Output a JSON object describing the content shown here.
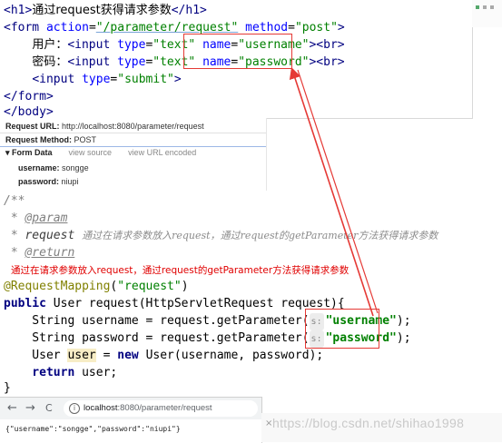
{
  "html_code": {
    "line1": {
      "open": "<h1>",
      "text": "通过request获得请求参数",
      "close": "</h1>"
    },
    "line2": {
      "prefix": "<form ",
      "action_attr": "action",
      "action_val": "\"/parameter/request\"",
      "method_attr": "method",
      "method_val": "\"post\"",
      "suffix": ">"
    },
    "line3": {
      "label": "用户：",
      "tag": "<input ",
      "type_attr": "type",
      "type_val": "\"text\"",
      "name_attr": "name",
      "name_val": "\"username\"",
      "suffix": "><br>"
    },
    "line4": {
      "label": "密码：",
      "tag": "<input ",
      "type_attr": "type",
      "type_val": "\"text\"",
      "name_attr": "name",
      "name_val": "\"password\"",
      "suffix": "><br>"
    },
    "line5": {
      "tag": "<input ",
      "type_attr": "type",
      "type_val": "\"submit\"",
      "suffix": ">"
    },
    "line6": "</form>",
    "line7": "</body>"
  },
  "devtools": {
    "request_url_label": "Request URL:",
    "request_url_value": "http://localhost:8080/parameter/request",
    "request_method_label": "Request Method:",
    "request_method_value": "POST",
    "form_data_label": "▾ Form Data",
    "view_source_link": "view source",
    "view_url_encoded_link": "view URL encoded",
    "fields": [
      {
        "key": "username:",
        "value": "songge"
      },
      {
        "key": "password:",
        "value": "niupi"
      }
    ]
  },
  "java_code": {
    "doc_open": "/**",
    "doc_star": " * ",
    "param_tag": "@param",
    "param_name": "request",
    "param_desc": "通过在请求参数放入request，通过request的getParameter方法获得请求参数",
    "return_tag": "@return",
    "annotation_note": "通过在请求参数放入request，通过request的getParameter方法获得请求参数",
    "mapping_annotation": "@RequestMapping",
    "mapping_value": "\"request\"",
    "method_sig_kw": "public ",
    "method_sig_rest": "User request(HttpServletRequest request){",
    "line_username_decl": "    String username = request.getParameter(",
    "line_password_decl": "    String password = request.getParameter(",
    "hint_s": "s:",
    "username_str": "\"username\"",
    "password_str": "\"password\"",
    "line_end": ");",
    "user_decl_type": "    User ",
    "user_decl_var": "user",
    "user_decl_eq": " = ",
    "new_kw": "new ",
    "user_decl_rest": "User(username, password);",
    "return_kw": "    return ",
    "return_rest": "user;",
    "close_brace": "}"
  },
  "browser": {
    "back": "←",
    "forward": "→",
    "reload": "C",
    "info": "i",
    "url_host": "localhost",
    "url_path": ":8080/parameter/request",
    "json_output": "{\"username\":\"songge\",\"password\":\"niupi\"}"
  },
  "watermark": {
    "close_glyph": "×",
    "text": "https://blog.csdn.net/shihao1998"
  },
  "colors": {
    "highlight_box": "#e53935",
    "arrow": "#e53935",
    "note": "#e00000"
  }
}
